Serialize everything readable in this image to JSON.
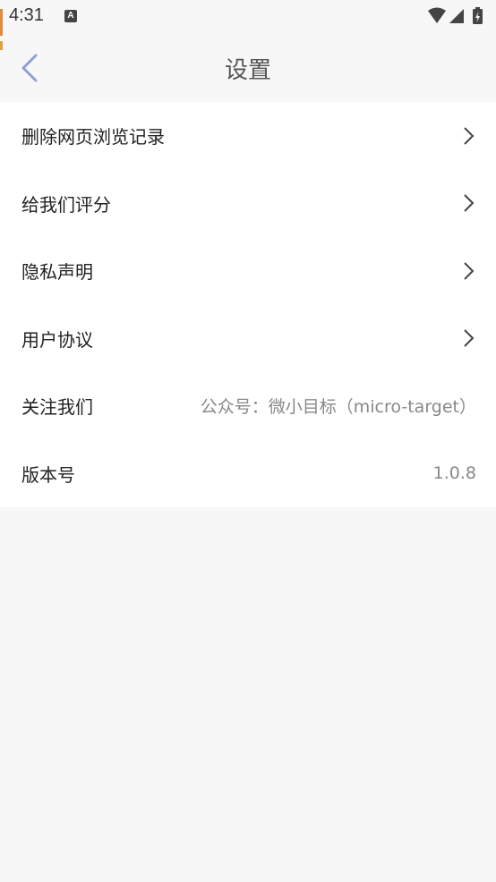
{
  "status_bar": {
    "time": "4:31",
    "app_icon_letter": "A"
  },
  "header": {
    "title": "设置"
  },
  "settings": {
    "items": [
      {
        "label": "删除网页浏览记录",
        "value": "",
        "has_chevron": true
      },
      {
        "label": "给我们评分",
        "value": "",
        "has_chevron": true
      },
      {
        "label": "隐私声明",
        "value": "",
        "has_chevron": true
      },
      {
        "label": "用户协议",
        "value": "",
        "has_chevron": true
      },
      {
        "label": "关注我们",
        "value": "公众号：微小目标（micro-target）",
        "has_chevron": false
      },
      {
        "label": "版本号",
        "value": "1.0.8",
        "has_chevron": false
      }
    ]
  },
  "colors": {
    "accent_back": "#8fa0d6",
    "background": "#f7f7f7",
    "list_background": "#ffffff"
  }
}
